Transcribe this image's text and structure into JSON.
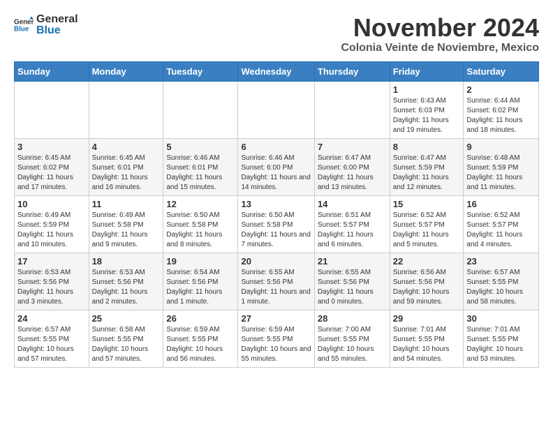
{
  "header": {
    "logo_general": "General",
    "logo_blue": "Blue",
    "month_title": "November 2024",
    "location": "Colonia Veinte de Noviembre, Mexico"
  },
  "calendar": {
    "weekdays": [
      "Sunday",
      "Monday",
      "Tuesday",
      "Wednesday",
      "Thursday",
      "Friday",
      "Saturday"
    ],
    "weeks": [
      [
        {
          "day": "",
          "info": ""
        },
        {
          "day": "",
          "info": ""
        },
        {
          "day": "",
          "info": ""
        },
        {
          "day": "",
          "info": ""
        },
        {
          "day": "",
          "info": ""
        },
        {
          "day": "1",
          "info": "Sunrise: 6:43 AM\nSunset: 6:03 PM\nDaylight: 11 hours and 19 minutes."
        },
        {
          "day": "2",
          "info": "Sunrise: 6:44 AM\nSunset: 6:02 PM\nDaylight: 11 hours and 18 minutes."
        }
      ],
      [
        {
          "day": "3",
          "info": "Sunrise: 6:45 AM\nSunset: 6:02 PM\nDaylight: 11 hours and 17 minutes."
        },
        {
          "day": "4",
          "info": "Sunrise: 6:45 AM\nSunset: 6:01 PM\nDaylight: 11 hours and 16 minutes."
        },
        {
          "day": "5",
          "info": "Sunrise: 6:46 AM\nSunset: 6:01 PM\nDaylight: 11 hours and 15 minutes."
        },
        {
          "day": "6",
          "info": "Sunrise: 6:46 AM\nSunset: 6:00 PM\nDaylight: 11 hours and 14 minutes."
        },
        {
          "day": "7",
          "info": "Sunrise: 6:47 AM\nSunset: 6:00 PM\nDaylight: 11 hours and 13 minutes."
        },
        {
          "day": "8",
          "info": "Sunrise: 6:47 AM\nSunset: 5:59 PM\nDaylight: 11 hours and 12 minutes."
        },
        {
          "day": "9",
          "info": "Sunrise: 6:48 AM\nSunset: 5:59 PM\nDaylight: 11 hours and 11 minutes."
        }
      ],
      [
        {
          "day": "10",
          "info": "Sunrise: 6:49 AM\nSunset: 5:59 PM\nDaylight: 11 hours and 10 minutes."
        },
        {
          "day": "11",
          "info": "Sunrise: 6:49 AM\nSunset: 5:58 PM\nDaylight: 11 hours and 9 minutes."
        },
        {
          "day": "12",
          "info": "Sunrise: 6:50 AM\nSunset: 5:58 PM\nDaylight: 11 hours and 8 minutes."
        },
        {
          "day": "13",
          "info": "Sunrise: 6:50 AM\nSunset: 5:58 PM\nDaylight: 11 hours and 7 minutes."
        },
        {
          "day": "14",
          "info": "Sunrise: 6:51 AM\nSunset: 5:57 PM\nDaylight: 11 hours and 6 minutes."
        },
        {
          "day": "15",
          "info": "Sunrise: 6:52 AM\nSunset: 5:57 PM\nDaylight: 11 hours and 5 minutes."
        },
        {
          "day": "16",
          "info": "Sunrise: 6:52 AM\nSunset: 5:57 PM\nDaylight: 11 hours and 4 minutes."
        }
      ],
      [
        {
          "day": "17",
          "info": "Sunrise: 6:53 AM\nSunset: 5:56 PM\nDaylight: 11 hours and 3 minutes."
        },
        {
          "day": "18",
          "info": "Sunrise: 6:53 AM\nSunset: 5:56 PM\nDaylight: 11 hours and 2 minutes."
        },
        {
          "day": "19",
          "info": "Sunrise: 6:54 AM\nSunset: 5:56 PM\nDaylight: 11 hours and 1 minute."
        },
        {
          "day": "20",
          "info": "Sunrise: 6:55 AM\nSunset: 5:56 PM\nDaylight: 11 hours and 1 minute."
        },
        {
          "day": "21",
          "info": "Sunrise: 6:55 AM\nSunset: 5:56 PM\nDaylight: 11 hours and 0 minutes."
        },
        {
          "day": "22",
          "info": "Sunrise: 6:56 AM\nSunset: 5:56 PM\nDaylight: 10 hours and 59 minutes."
        },
        {
          "day": "23",
          "info": "Sunrise: 6:57 AM\nSunset: 5:55 PM\nDaylight: 10 hours and 58 minutes."
        }
      ],
      [
        {
          "day": "24",
          "info": "Sunrise: 6:57 AM\nSunset: 5:55 PM\nDaylight: 10 hours and 57 minutes."
        },
        {
          "day": "25",
          "info": "Sunrise: 6:58 AM\nSunset: 5:55 PM\nDaylight: 10 hours and 57 minutes."
        },
        {
          "day": "26",
          "info": "Sunrise: 6:59 AM\nSunset: 5:55 PM\nDaylight: 10 hours and 56 minutes."
        },
        {
          "day": "27",
          "info": "Sunrise: 6:59 AM\nSunset: 5:55 PM\nDaylight: 10 hours and 55 minutes."
        },
        {
          "day": "28",
          "info": "Sunrise: 7:00 AM\nSunset: 5:55 PM\nDaylight: 10 hours and 55 minutes."
        },
        {
          "day": "29",
          "info": "Sunrise: 7:01 AM\nSunset: 5:55 PM\nDaylight: 10 hours and 54 minutes."
        },
        {
          "day": "30",
          "info": "Sunrise: 7:01 AM\nSunset: 5:55 PM\nDaylight: 10 hours and 53 minutes."
        }
      ]
    ]
  }
}
